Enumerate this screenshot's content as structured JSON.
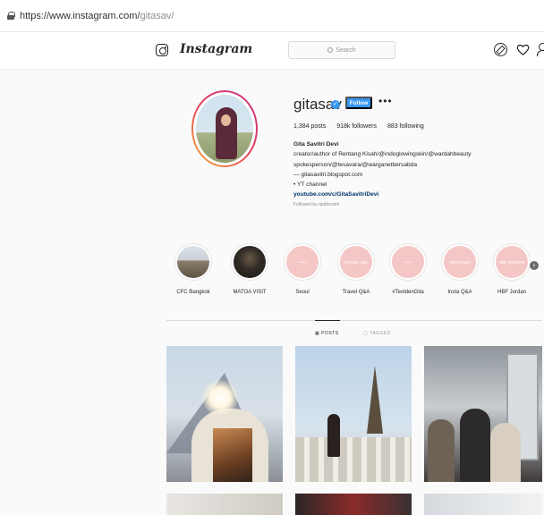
{
  "browser": {
    "url_base": "https://www.instagram.com/",
    "url_path": "gitasav/"
  },
  "nav": {
    "brand": "Instagram",
    "search_placeholder": "Search"
  },
  "profile": {
    "username": "gitasav",
    "follow_label": "Follow",
    "more_label": "•••",
    "stats": {
      "posts": "1,384 posts",
      "followers": "918k followers",
      "following": "883 following"
    },
    "bio": {
      "full_name": "Gita Savitri Devi",
      "line1": "creator/author of Rentang Kisah/@indoglowingskin/@wardahbeauty",
      "line2": "spokesperson/@tesavara/@warganetbersabda",
      "line3": "— gitasavitri.blogspot.com",
      "line4": "• YT channel",
      "website": "youtube.com/c/GitaSavitriDevi",
      "followed_by": "Followed by apribnaiml"
    }
  },
  "highlights": [
    {
      "label": "CFC Bangkok",
      "cover_text": ""
    },
    {
      "label": "MATOA VISIT",
      "cover_text": ""
    },
    {
      "label": "Seoul",
      "cover_text": "• • • •"
    },
    {
      "label": "Travel Q&A",
      "cover_text": "TRAVEL Q&A"
    },
    {
      "label": "#TeoldenGita",
      "cover_text": "• • •"
    },
    {
      "label": "Insta Q&A",
      "cover_text": "INSTA Q&A"
    },
    {
      "label": "HBF Jordan",
      "cover_text": "HBF JORDAN"
    }
  ],
  "highlights_next": "›",
  "tabs": {
    "posts": "▦ POSTS",
    "tagged": "▢ TAGGED"
  },
  "colors": {
    "follow_blue": "#3897f0",
    "highlight_pink": "#f4c7c6",
    "link_navy": "#003569"
  }
}
